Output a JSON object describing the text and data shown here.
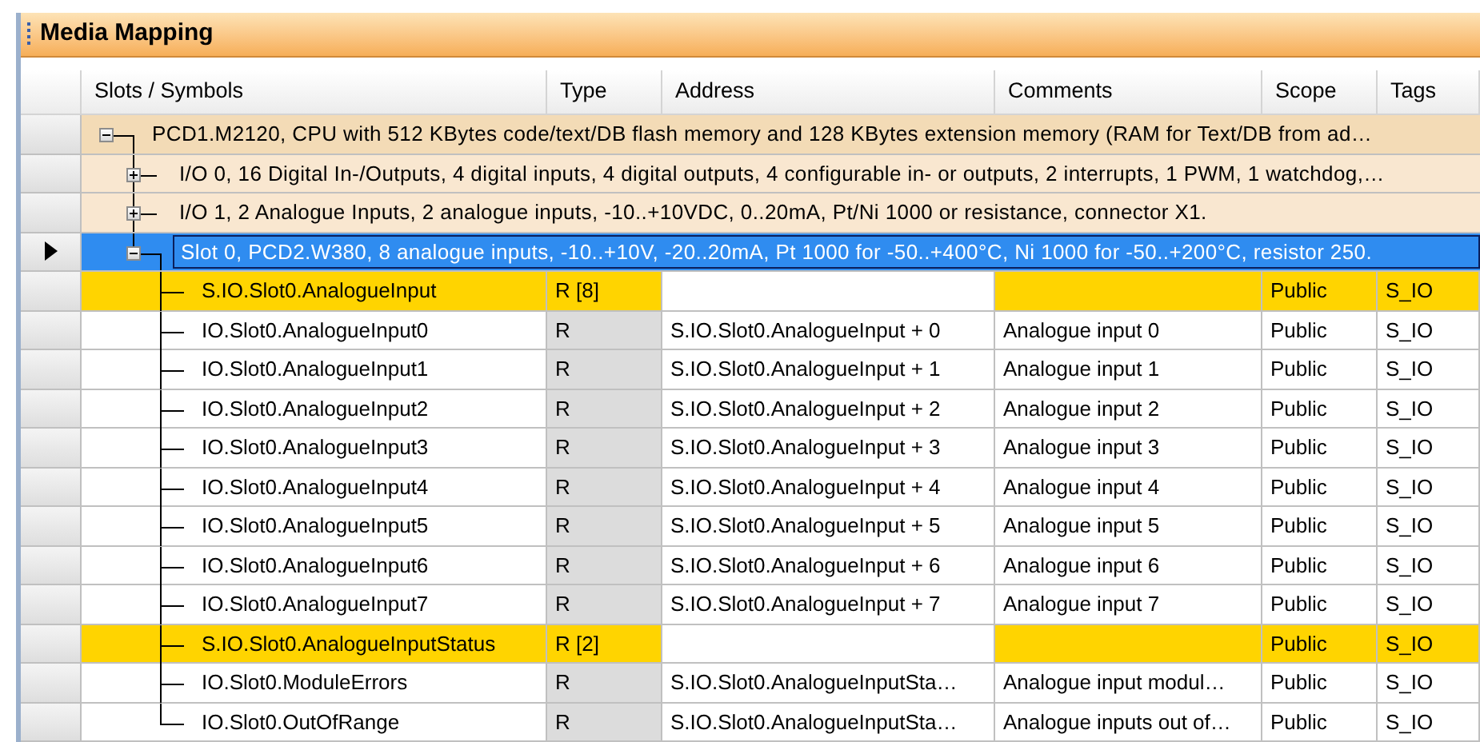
{
  "window": {
    "title": "Media Mapping"
  },
  "table": {
    "columns": [
      "Slots / Symbols",
      "Type",
      "Address",
      "Comments",
      "Scope",
      "Tags"
    ],
    "tree": [
      {
        "kind": "group",
        "text": "PCD1.M2120, CPU with 512 KBytes code/text/DB flash memory and 128 KBytes extension memory (RAM for Text/DB from ad…",
        "expanded": true,
        "selected": false,
        "children": [
          {
            "kind": "group",
            "text": "I/O 0, 16 Digital In-/Outputs, 4 digital inputs, 4 digital outputs, 4 configurable in- or outputs, 2 interrupts, 1 PWM, 1 watchdog,…",
            "expanded": false,
            "selected": false
          },
          {
            "kind": "group",
            "text": "I/O 1, 2 Analogue Inputs, 2 analogue inputs, -10..+10VDC, 0..20mA, Pt/Ni 1000 or resistance, connector X1.",
            "expanded": false,
            "selected": false
          },
          {
            "kind": "group",
            "text": "Slot 0, PCD2.W380, 8 analogue inputs, -10..+10V, -20..20mA, Pt 1000 for -50..+400°C, Ni 1000 for -50..+200°C, resistor 250.",
            "expanded": true,
            "selected": true,
            "children": [
              {
                "kind": "symbol",
                "name": "S.IO.Slot0.AnalogueInput",
                "type": "R [8]",
                "scope": "Public",
                "tags": "S_IO",
                "highlighted": true,
                "selected": false
              },
              {
                "kind": "symbol",
                "name": "IO.Slot0.AnalogueInput0",
                "type": "R",
                "address": "S.IO.Slot0.AnalogueInput + 0",
                "comment": "Analogue input 0",
                "scope": "Public",
                "tags": "S_IO",
                "highlighted": false,
                "selected": false
              },
              {
                "kind": "symbol",
                "name": "IO.Slot0.AnalogueInput1",
                "type": "R",
                "address": "S.IO.Slot0.AnalogueInput + 1",
                "comment": "Analogue input 1",
                "scope": "Public",
                "tags": "S_IO",
                "highlighted": false,
                "selected": false
              },
              {
                "kind": "symbol",
                "name": "IO.Slot0.AnalogueInput2",
                "type": "R",
                "address": "S.IO.Slot0.AnalogueInput + 2",
                "comment": "Analogue input 2",
                "scope": "Public",
                "tags": "S_IO",
                "highlighted": false,
                "selected": false
              },
              {
                "kind": "symbol",
                "name": "IO.Slot0.AnalogueInput3",
                "type": "R",
                "address": "S.IO.Slot0.AnalogueInput + 3",
                "comment": "Analogue input 3",
                "scope": "Public",
                "tags": "S_IO",
                "highlighted": false,
                "selected": false
              },
              {
                "kind": "symbol",
                "name": "IO.Slot0.AnalogueInput4",
                "type": "R",
                "address": "S.IO.Slot0.AnalogueInput + 4",
                "comment": "Analogue input 4",
                "scope": "Public",
                "tags": "S_IO",
                "highlighted": false,
                "selected": false
              },
              {
                "kind": "symbol",
                "name": "IO.Slot0.AnalogueInput5",
                "type": "R",
                "address": "S.IO.Slot0.AnalogueInput + 5",
                "comment": "Analogue input 5",
                "scope": "Public",
                "tags": "S_IO",
                "highlighted": false,
                "selected": false
              },
              {
                "kind": "symbol",
                "name": "IO.Slot0.AnalogueInput6",
                "type": "R",
                "address": "S.IO.Slot0.AnalogueInput + 6",
                "comment": "Analogue input 6",
                "scope": "Public",
                "tags": "S_IO",
                "highlighted": false,
                "selected": false
              },
              {
                "kind": "symbol",
                "name": "IO.Slot0.AnalogueInput7",
                "type": "R",
                "address": "S.IO.Slot0.AnalogueInput + 7",
                "comment": "Analogue input 7",
                "scope": "Public",
                "tags": "S_IO",
                "highlighted": false,
                "selected": false
              },
              {
                "kind": "symbol",
                "name": "S.IO.Slot0.AnalogueInputStatus",
                "type": "R [2]",
                "scope": "Public",
                "tags": "S_IO",
                "highlighted": true,
                "selected": false
              },
              {
                "kind": "symbol",
                "name": "IO.Slot0.ModuleErrors",
                "type": "R",
                "address": "S.IO.Slot0.AnalogueInputSta…",
                "comment": "Analogue input modul…",
                "scope": "Public",
                "tags": "S_IO",
                "highlighted": false,
                "selected": false
              },
              {
                "kind": "symbol",
                "name": "IO.Slot0.OutOfRange",
                "type": "R",
                "address": "S.IO.Slot0.AnalogueInputSta…",
                "comment": "Analogue inputs out of…",
                "scope": "Public",
                "tags": "S_IO",
                "highlighted": false,
                "selected": false
              }
            ]
          }
        ]
      }
    ]
  }
}
